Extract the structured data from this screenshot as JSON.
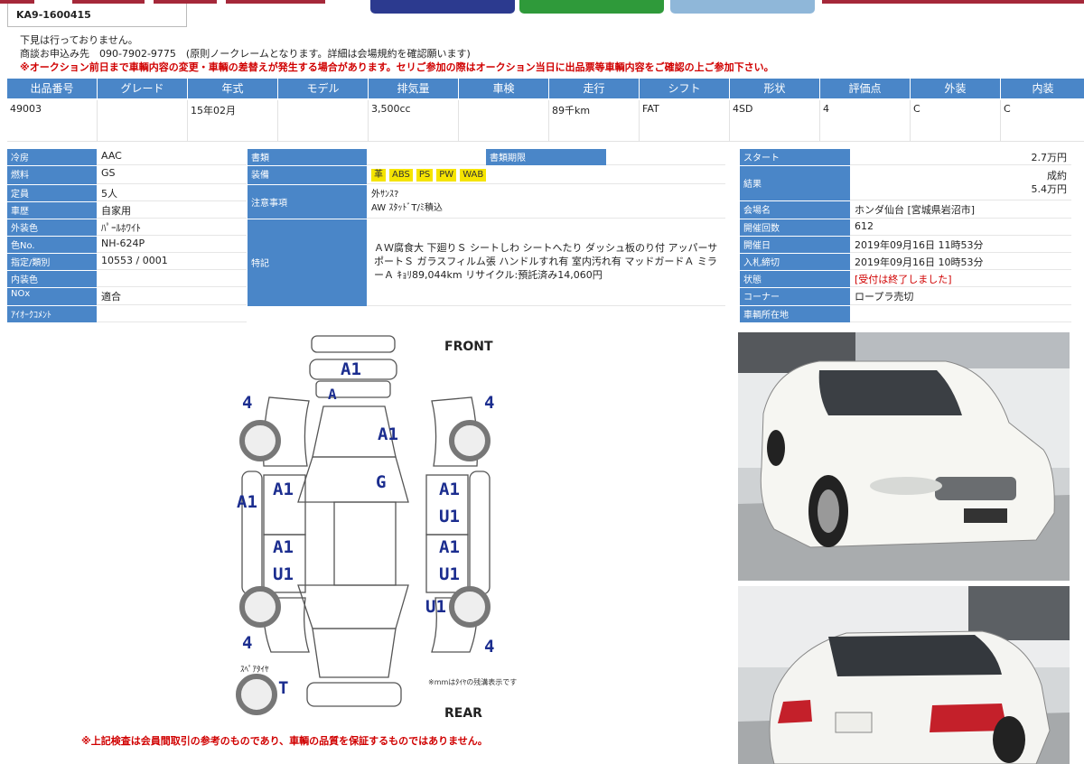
{
  "header": {
    "lot_code": "KA9-1600415"
  },
  "notices": {
    "preview": "下見は行っておりません。",
    "contact": "商談お申込み先　090-7902-9775　(原則ノークレームとなります。詳細は会場規約を確認願います)",
    "warning": "※オークション前日まで車輌内容の変更・車輌の差替えが発生する場合があります。セリご参加の際はオークション当日に出品票等車輌内容をご確認の上ご参加下さい。"
  },
  "spec_table": {
    "headers": [
      "出品番号",
      "グレード",
      "年式",
      "モデル",
      "排気量",
      "車検",
      "走行",
      "シフト",
      "形状",
      "評価点",
      "外装",
      "内装"
    ],
    "values": [
      "49003",
      "",
      "15年02月",
      "",
      "3,500cc",
      "",
      "89千km",
      "FAT",
      "4SD",
      "4",
      "C",
      "C"
    ]
  },
  "left_details": {
    "rows": [
      {
        "label": "冷房",
        "value": "AAC"
      },
      {
        "label": "燃料",
        "value": "GS"
      },
      {
        "label": "定員",
        "value": "5人"
      },
      {
        "label": "車歴",
        "value": "自家用"
      },
      {
        "label": "外装色",
        "value": "ﾊﾟｰﾙﾎﾜｲﾄ"
      },
      {
        "label": "色No.",
        "value": "NH-624P"
      },
      {
        "label": "指定/類別",
        "value": "10553 / 0001"
      },
      {
        "label": "内装色",
        "value": ""
      },
      {
        "label": "NOx",
        "value": "適合"
      },
      {
        "label": "ｱｲｵｰｸｺﾒﾝﾄ",
        "value": ""
      }
    ]
  },
  "mid_details": {
    "documents_label": "書類",
    "documents_deadline_label": "書類期限",
    "equipment_label": "装備",
    "equipment": [
      "革",
      "ABS",
      "PS",
      "PW",
      "WAB"
    ],
    "notes_label": "注意事項",
    "notes_line1": "外ｻﾝｽ?",
    "notes_line2": "AW ｽﾀｯﾄﾞT/ﾐ積込",
    "features_label": "特記",
    "features_text": "ＡＷ腐食大 下廻りＳ シートしわ シートへたり ダッシュ板のり付 アッパーサポートＳ ガラスフィルム張 ハンドルすれ有 室内汚れ有 マッドガードＡ ミラーＡ ｷｮﾘ89,044km リサイクル:預託済み14,060円"
  },
  "right_details": {
    "rows": [
      {
        "label": "スタート",
        "value": "2.7万円"
      },
      {
        "label": "結果",
        "value": "成約",
        "value2": "5.4万円"
      },
      {
        "label": "会場名",
        "value": "ホンダ仙台 [宮城県岩沼市]"
      },
      {
        "label": "開催回数",
        "value": "612"
      },
      {
        "label": "開催日",
        "value": "2019年09月16日 11時53分"
      },
      {
        "label": "入札締切",
        "value": "2019年09月16日 10時53分"
      },
      {
        "label": "状態",
        "value": "[受付は終了しました]"
      },
      {
        "label": "コーナー",
        "value": "ロープラ売切"
      },
      {
        "label": "車輌所在地",
        "value": ""
      }
    ]
  },
  "diagram": {
    "front_label": "FRONT",
    "rear_label": "REAR",
    "spare_label": "ｽﾍﾟｱﾀｲﾔ",
    "spare_mark": "T",
    "legend": "※mmはﾀｲﾔの残溝表示です",
    "marks": {
      "bumper_front": "A1",
      "grille": "A",
      "hood": "A1",
      "roof": "G",
      "left_panel": "A1",
      "left_door_front": "A1",
      "left_door_rear_1": "A1",
      "left_door_rear_2": "U1",
      "right_door_front_1": "A1",
      "right_door_front_2": "U1",
      "right_door_rear_1": "A1",
      "right_door_rear_2": "U1",
      "rear_wheel_right": "U1",
      "tire_fl": "4",
      "tire_fr": "4",
      "tire_rl": "4",
      "tire_rr": "4"
    },
    "footnote": "※上記検査は会員間取引の参考のものであり、車輌の品質を保証するものではありません。"
  },
  "colors": {
    "header_blue": "#4a86c8",
    "warning_red": "#d00000",
    "diagram_blue": "#1b2d8f",
    "equip_yellow": "#f5e400"
  }
}
